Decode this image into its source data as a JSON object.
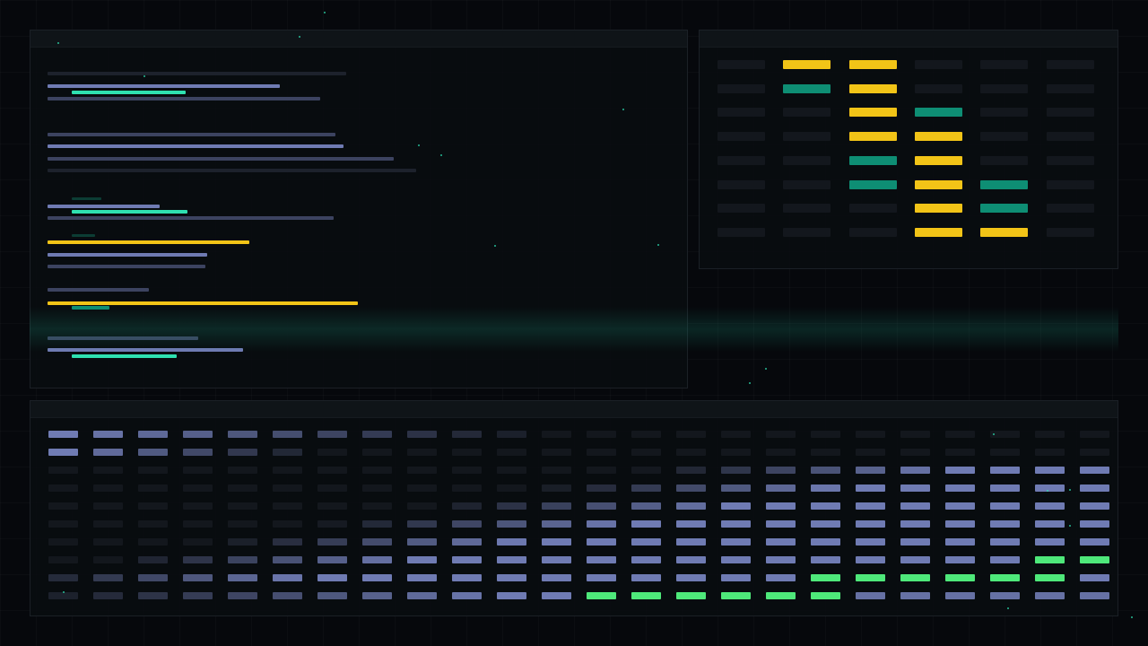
{
  "colors": {
    "lavender": "#6f7bb3",
    "slate": "#3c4360",
    "dim": "#1d222c",
    "faint": "#13171d",
    "cyan": "#2fe0b0",
    "teal": "#0e8e74",
    "darkteal": "#0c3d34",
    "yellow": "#f2c417",
    "green": "#4ee87a"
  },
  "code_panel": {
    "lines": [
      {
        "indent": 0,
        "len": 333,
        "color": "dim"
      },
      {
        "indent": 0,
        "len": 259,
        "color": "lavender"
      },
      {
        "indent": 1,
        "len": 127,
        "color": "cyan"
      },
      {
        "indent": 0,
        "len": 304,
        "color": "slate"
      },
      {
        "indent": 0,
        "len": 321,
        "color": "slate"
      },
      {
        "indent": 0,
        "len": 330,
        "color": "lavender"
      },
      {
        "indent": 0,
        "len": 386,
        "color": "slate"
      },
      {
        "indent": 0,
        "len": 411,
        "color": "dim"
      },
      {
        "indent": 1,
        "len": 33,
        "color": "darkteal"
      },
      {
        "indent": 0,
        "len": 125,
        "color": "lavender"
      },
      {
        "indent": 1,
        "len": 129,
        "color": "cyan"
      },
      {
        "indent": 0,
        "len": 319,
        "color": "slate"
      },
      {
        "indent": 1,
        "len": 26,
        "color": "darkteal"
      },
      {
        "indent": 0,
        "len": 225,
        "color": "yellow"
      },
      {
        "indent": 0,
        "len": 178,
        "color": "lavender"
      },
      {
        "indent": 0,
        "len": 176,
        "color": "slate"
      },
      {
        "indent": 0,
        "len": 113,
        "color": "slate"
      },
      {
        "indent": 0,
        "len": 346,
        "color": "yellow"
      },
      {
        "indent": 1,
        "len": 42,
        "color": "teal"
      },
      {
        "indent": 0,
        "len": 168,
        "color": "slate"
      },
      {
        "indent": 0,
        "len": 218,
        "color": "lavender"
      },
      {
        "indent": 1,
        "len": 117,
        "color": "cyan"
      }
    ]
  },
  "matrix_panel": {
    "rows": [
      [
        "faint",
        "yellow",
        "yellow",
        "faint",
        "faint",
        "faint"
      ],
      [
        "faint",
        "teal",
        "yellow",
        "faint",
        "faint",
        "faint"
      ],
      [
        "faint",
        "faint",
        "yellow",
        "teal",
        "faint",
        "faint"
      ],
      [
        "faint",
        "faint",
        "yellow",
        "yellow",
        "faint",
        "faint"
      ],
      [
        "faint",
        "faint",
        "teal",
        "yellow",
        "faint",
        "faint"
      ],
      [
        "faint",
        "faint",
        "teal",
        "yellow",
        "teal",
        "faint"
      ],
      [
        "faint",
        "faint",
        "faint",
        "yellow",
        "teal",
        "faint"
      ],
      [
        "faint",
        "faint",
        "faint",
        "yellow",
        "yellow",
        "faint"
      ]
    ]
  },
  "waterfall_panel": {
    "columns": 24,
    "rows": 10
  }
}
